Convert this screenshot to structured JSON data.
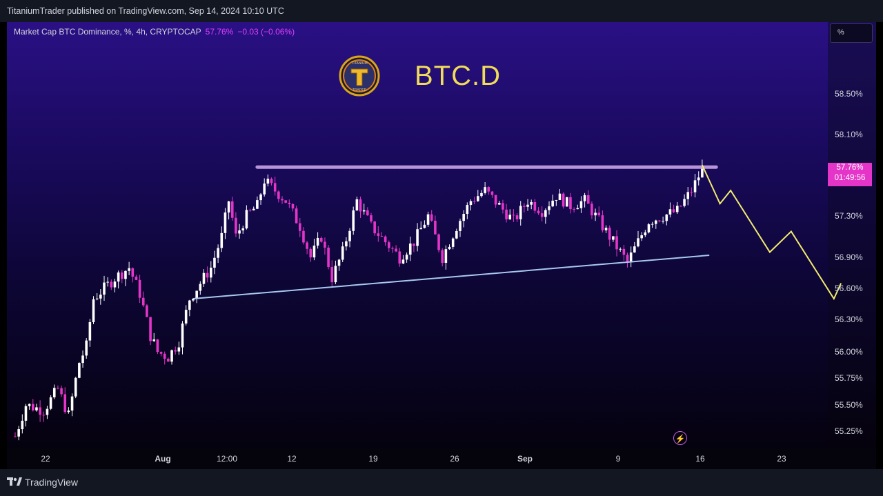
{
  "header": {
    "text": "TitaniumTrader published on TradingView.com, Sep 14, 2024 10:10 UTC"
  },
  "legend": {
    "name": "Market Cap BTC Dominance, %, 4h, CRYPTOCAP",
    "value": "57.76%",
    "change": "−0.03 (−0.06%)"
  },
  "title": "BTC.D",
  "logo": {
    "icon": "titanium-trader-logo",
    "text_top": "TITANIUM",
    "text_bottom": "TRADER"
  },
  "unit_button": "%",
  "price_label": {
    "price": "57.76%",
    "countdown": "01:49:56"
  },
  "footer": {
    "brand": "TradingView"
  },
  "colors": {
    "bull": "#ffffff",
    "bear": "#e535c9",
    "resistance": "#c9a3e6",
    "support": "#a8c8f0",
    "projection": "#f2ec6e",
    "title": "#f0dc5a"
  },
  "chart_data": {
    "type": "candlestick",
    "symbol": "BTC.D",
    "interval": "4h",
    "y_ticks": [
      "58.50%",
      "58.10%",
      "57.30%",
      "56.90%",
      "56.60%",
      "56.30%",
      "56.00%",
      "55.75%",
      "55.50%",
      "55.25%"
    ],
    "x_ticks": [
      "22",
      "Aug",
      "12:00",
      "12",
      "19",
      "26",
      "Sep",
      "9",
      "16",
      "23"
    ],
    "ylim": [
      55.1,
      58.9
    ],
    "close_path": [
      [
        0,
        55.2
      ],
      [
        3,
        55.5
      ],
      [
        8,
        55.45
      ],
      [
        12,
        55.65
      ],
      [
        15,
        55.4
      ],
      [
        18,
        55.9
      ],
      [
        20,
        56.05
      ],
      [
        22,
        56.5
      ],
      [
        25,
        56.6
      ],
      [
        28,
        56.7
      ],
      [
        32,
        56.8
      ],
      [
        35,
        56.55
      ],
      [
        38,
        56.15
      ],
      [
        40,
        56.0
      ],
      [
        43,
        55.95
      ],
      [
        46,
        56.1
      ],
      [
        49,
        56.5
      ],
      [
        52,
        56.65
      ],
      [
        55,
        56.8
      ],
      [
        58,
        57.1
      ],
      [
        60,
        57.45
      ],
      [
        62,
        57.1
      ],
      [
        65,
        57.3
      ],
      [
        68,
        57.4
      ],
      [
        70,
        57.65
      ],
      [
        73,
        57.55
      ],
      [
        76,
        57.45
      ],
      [
        80,
        57.2
      ],
      [
        83,
        56.9
      ],
      [
        86,
        57.1
      ],
      [
        89,
        56.7
      ],
      [
        92,
        56.95
      ],
      [
        96,
        57.45
      ],
      [
        100,
        57.2
      ],
      [
        104,
        57.05
      ],
      [
        108,
        56.9
      ],
      [
        112,
        57.05
      ],
      [
        116,
        57.3
      ],
      [
        120,
        56.9
      ],
      [
        124,
        57.2
      ],
      [
        128,
        57.45
      ],
      [
        132,
        57.55
      ],
      [
        136,
        57.4
      ],
      [
        140,
        57.25
      ],
      [
        144,
        57.45
      ],
      [
        148,
        57.35
      ],
      [
        152,
        57.5
      ],
      [
        156,
        57.4
      ],
      [
        160,
        57.45
      ],
      [
        164,
        57.25
      ],
      [
        168,
        57.05
      ],
      [
        172,
        56.85
      ],
      [
        175,
        57.05
      ],
      [
        178,
        57.25
      ],
      [
        182,
        57.3
      ],
      [
        186,
        57.35
      ],
      [
        190,
        57.55
      ],
      [
        193,
        57.76
      ]
    ],
    "annotations": {
      "resistance": {
        "from_index": 68,
        "to_index": 195,
        "y": 57.78
      },
      "support": {
        "from_index": 50,
        "to_index": 195,
        "y_start": 56.5,
        "y_end": 56.92
      },
      "projection": [
        [
          193,
          57.8
        ],
        [
          198,
          57.42
        ],
        [
          201,
          57.55
        ],
        [
          212,
          56.95
        ],
        [
          218,
          57.15
        ],
        [
          230,
          56.5
        ],
        [
          232,
          56.65
        ]
      ]
    }
  }
}
